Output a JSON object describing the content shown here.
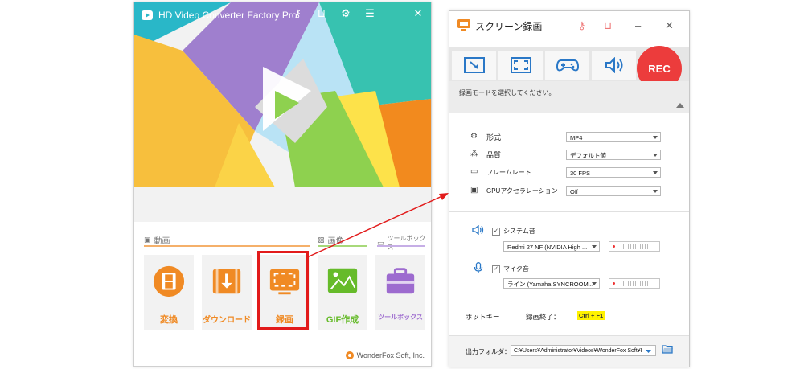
{
  "left_window": {
    "title": "HD Video Converter Factory Pro",
    "sections": {
      "video": "動画",
      "image": "画像",
      "tools": "ツールボックス"
    },
    "tiles": [
      {
        "label": "変換",
        "color": "#f08a24"
      },
      {
        "label": "ダウンロード",
        "color": "#f08a24"
      },
      {
        "label": "録画",
        "color": "#f08a24"
      },
      {
        "label": "GIF作成",
        "color": "#66bb2a"
      },
      {
        "label": "ツールボックス",
        "color": "#9d6bcf"
      }
    ],
    "footer": "WonderFox Soft, Inc."
  },
  "right_window": {
    "title": "スクリーン録画",
    "rec_label": "REC",
    "hint": "録画モードを選択してください。",
    "settings": [
      {
        "label": "形式",
        "value": "MP4"
      },
      {
        "label": "品質",
        "value": "デフォルト値"
      },
      {
        "label": "フレームレート",
        "value": "30 FPS"
      },
      {
        "label": "GPUアクセラレーション",
        "value": "Off"
      }
    ],
    "audio": {
      "system_label": "システム音",
      "system_device": "Redmi 27 NF (NVIDIA High ...",
      "mic_label": "マイク音",
      "mic_device": "ライン (Yamaha SYNCROOM..."
    },
    "hotkey": {
      "label": "ホットキー",
      "action": "録画終了：",
      "key": "Ctrl + F1"
    },
    "output": {
      "label": "出力フォルダ：",
      "path": "C:¥Users¥Administrator¥Videos¥WonderFox Soft¥HD V"
    }
  },
  "colors": {
    "accent_red": "#e21b1b",
    "rec_red": "#ec3c3c",
    "mode_icon_blue": "#2a78c7"
  }
}
